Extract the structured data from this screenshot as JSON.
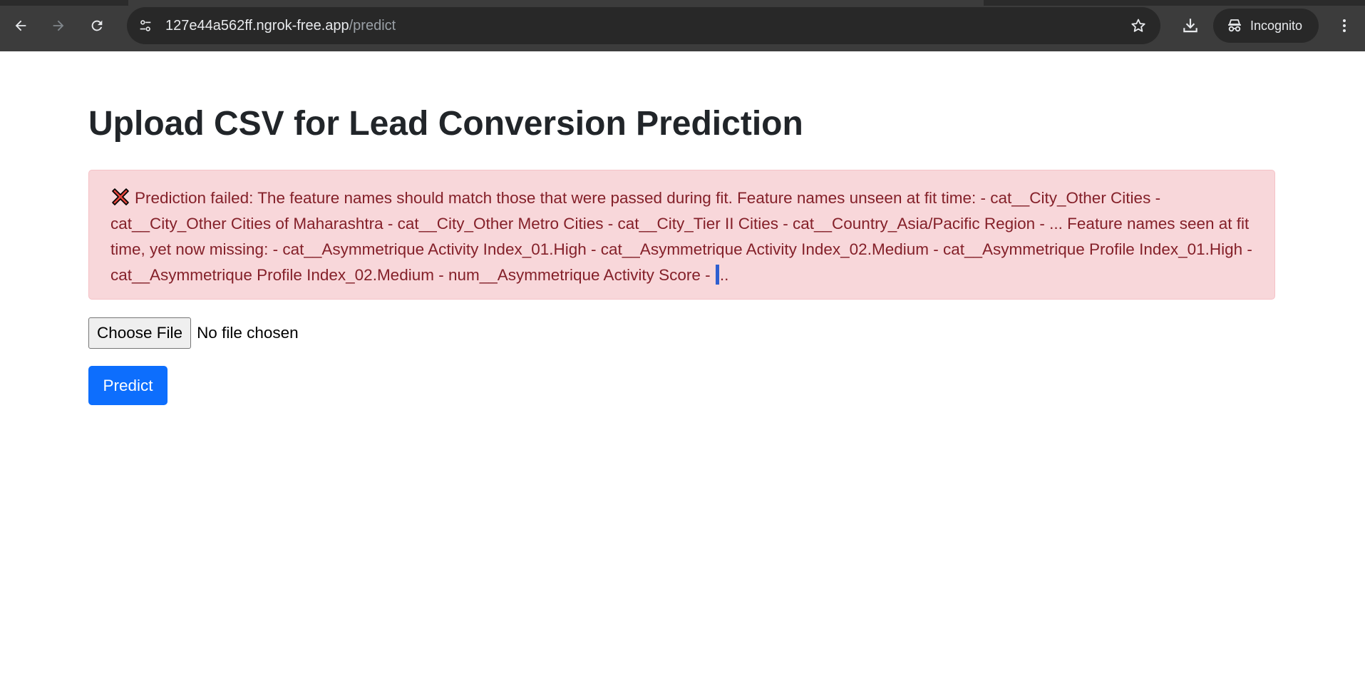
{
  "browser": {
    "url_host": "127e44a562ff.ngrok-free.app",
    "url_path": "/predict",
    "profile_label": "Incognito"
  },
  "page": {
    "title": "Upload CSV for Lead Conversion Prediction",
    "alert": {
      "icon": "cross-mark-icon",
      "message_main": "Prediction failed: The feature names should match those that were passed during fit. Feature names unseen at fit time: - cat__City_Other Cities - cat__City_Other Cities of Maharashtra - cat__City_Other Metro Cities - cat__City_Tier II Cities - cat__Country_Asia/Pacific Region - ... Feature names seen at fit time, yet now missing: - cat__Asymmetrique Activity Index_01.High - cat__Asymmetrique Activity Index_02.Medium - cat__Asymmetrique Profile Index_01.High - cat__Asymmetrique Profile Index_02.Medium - num__Asymmetrique Activity Score - ",
      "message_end": "..",
      "color_bg": "#f8d7da",
      "color_text": "#842029"
    },
    "file_input": {
      "button_label": "Choose File",
      "status": "No file chosen"
    },
    "submit": {
      "label": "Predict",
      "color": "#0d6efd"
    }
  }
}
